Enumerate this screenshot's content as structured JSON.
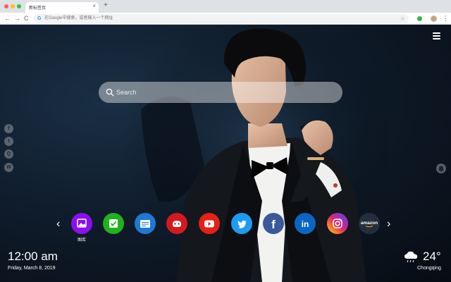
{
  "browser": {
    "tab_title": "新标签页",
    "tab_close": "×",
    "new_tab": "+",
    "nav_back": "←",
    "nav_forward": "→",
    "nav_reload": "C",
    "google_letter": "G",
    "omnibox_placeholder": "在Google中搜索，或者输入一个网址",
    "star": "☆",
    "menu": "⋮"
  },
  "search": {
    "placeholder": "Search"
  },
  "social": [
    {
      "name": "facebook",
      "glyph": "f"
    },
    {
      "name": "twitter",
      "glyph": "t"
    },
    {
      "name": "qq",
      "glyph": "Q"
    },
    {
      "name": "wechat",
      "glyph": "W"
    }
  ],
  "dock": {
    "prev": "‹",
    "next": "›",
    "apps": [
      {
        "name": "gallery",
        "label": "图库",
        "color": "#8a10f0"
      },
      {
        "name": "todo",
        "label": "",
        "color": "#1fb11f"
      },
      {
        "name": "notes",
        "label": "",
        "color": "#1e78d6"
      },
      {
        "name": "games",
        "label": "",
        "color": "#d31920"
      },
      {
        "name": "youtube",
        "label": "",
        "color": "#e62117"
      },
      {
        "name": "twitter",
        "label": "",
        "color": "#1d9bf0"
      },
      {
        "name": "facebook",
        "label": "",
        "color": "#3b5998",
        "glyph": "f"
      },
      {
        "name": "linkedin",
        "label": "",
        "color": "#0a66c2",
        "glyph": "in"
      },
      {
        "name": "instagram",
        "label": "",
        "color": "#d62976"
      },
      {
        "name": "amazon",
        "label": "",
        "color": "#232f3e",
        "glyph": "amazon"
      }
    ]
  },
  "clock": {
    "time": "12:00 am",
    "date": "Friday, March 8, 2019"
  },
  "weather": {
    "icon": "rain-cloud-icon",
    "temp": "24°",
    "city": "Chongqing"
  }
}
